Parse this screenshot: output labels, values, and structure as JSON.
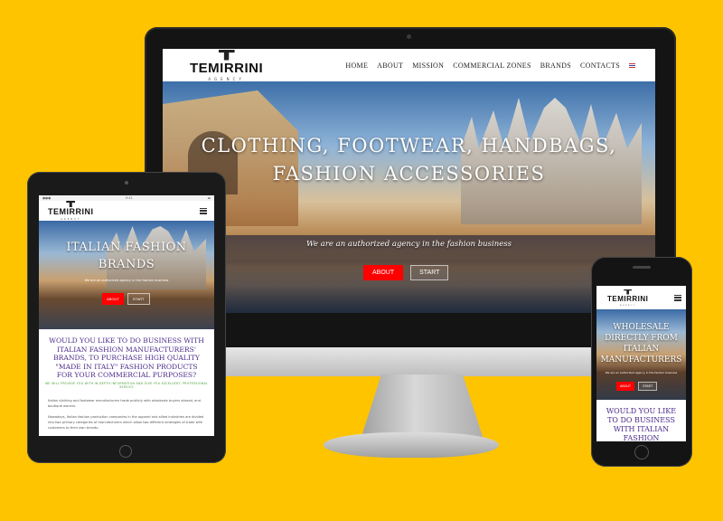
{
  "brand": {
    "name": "TEMIRRINI",
    "sub": "AGENCY"
  },
  "colors": {
    "background": "#FFC400",
    "accent_red": "#FF0000",
    "heading_purple": "#4B2A8A",
    "tagline_green": "#4AA03A"
  },
  "desktop": {
    "nav": [
      "HOME",
      "ABOUT",
      "MISSION",
      "COMMERCIAL ZONES",
      "BRANDS",
      "CONTACTS"
    ],
    "hero_title": "CLOTHING, FOOTWEAR, HANDBAGS, FASHION ACCESSORIES",
    "hero_subtitle": "We are an authorized agency in the fashion business",
    "about_label": "ABOUT",
    "start_label": "START"
  },
  "tablet": {
    "status_time": "9:41",
    "hero_title": "ITALIAN FASHION BRANDS",
    "hero_subtitle": "We are an authorized agency in the fashion business",
    "about_label": "ABOUT",
    "start_label": "START",
    "question": "WOULD YOU LIKE TO DO BUSINESS WITH ITALIAN FASHION MANUFACTURERS' BRANDS, TO PURCHASE HIGH QUALITY \"MADE IN ITALY\" FASHION PRODUCTS FOR YOUR COMMERCIAL PURPOSES?",
    "green_tagline": "WE WILL PROVIDE YOU WITH IN-DEPTH INFORMATION AND GIVE YOU EXCELLENT, PROFESSIONAL SERVICE",
    "body_1": "Italian clothing and footwear manufacturers trade publicly with wholesale buyers abroad, and boutique owners.",
    "body_2": "Nowadays, Italian fashion production companies in the apparel and allied industries are divided into two primary categories of manufacturers which allow two different strategies of trade with customers to their own brands."
  },
  "phone": {
    "hero_title": "WHOLESALE DIRECTLY FROM ITALIAN MANUFACTURERS",
    "hero_subtitle": "We are an authorized agency in the fashion business",
    "about_label": "ABOUT",
    "start_label": "START",
    "question": "WOULD YOU LIKE TO DO BUSINESS WITH ITALIAN FASHION MANUFACTURERS'"
  }
}
